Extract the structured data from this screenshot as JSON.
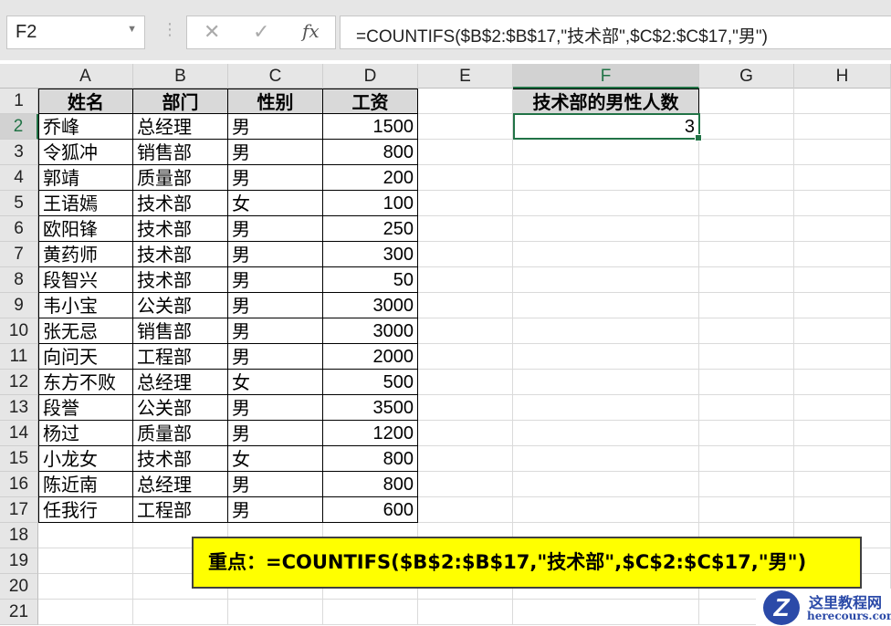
{
  "formula_bar": {
    "name_box": "F2",
    "cancel_icon": "✕",
    "enter_icon": "✓",
    "fx_label": "fx",
    "formula": "=COUNTIFS($B$2:$B$17,\"技术部\",$C$2:$C$17,\"男\")"
  },
  "columns": [
    "A",
    "B",
    "C",
    "D",
    "E",
    "F",
    "G",
    "H"
  ],
  "selected_cell": "F2",
  "table": {
    "headers": [
      "姓名",
      "部门",
      "性别",
      "工资"
    ],
    "rows": [
      [
        "乔峰",
        "总经理",
        "男",
        "1500"
      ],
      [
        "令狐冲",
        "销售部",
        "男",
        "800"
      ],
      [
        "郭靖",
        "质量部",
        "男",
        "200"
      ],
      [
        "王语嫣",
        "技术部",
        "女",
        "100"
      ],
      [
        "欧阳锋",
        "技术部",
        "男",
        "250"
      ],
      [
        "黄药师",
        "技术部",
        "男",
        "300"
      ],
      [
        "段智兴",
        "技术部",
        "男",
        "50"
      ],
      [
        "韦小宝",
        "公关部",
        "男",
        "3000"
      ],
      [
        "张无忌",
        "销售部",
        "男",
        "3000"
      ],
      [
        "向问天",
        "工程部",
        "男",
        "2000"
      ],
      [
        "东方不败",
        "总经理",
        "女",
        "500"
      ],
      [
        "段誉",
        "公关部",
        "男",
        "3500"
      ],
      [
        "杨过",
        "质量部",
        "男",
        "1200"
      ],
      [
        "小龙女",
        "技术部",
        "女",
        "800"
      ],
      [
        "陈近南",
        "总经理",
        "男",
        "800"
      ],
      [
        "任我行",
        "工程部",
        "男",
        "600"
      ]
    ]
  },
  "result": {
    "header": "技术部的男性人数",
    "value": "3"
  },
  "callout": "重点：=COUNTIFS($B$2:$B$17,\"技术部\",$C$2:$C$17,\"男\")",
  "watermark": {
    "title": "这里教程网",
    "url": "herecours.com"
  },
  "colors": {
    "accent": "#217346",
    "callout_bg": "#ffff00",
    "header_fill": "#d9d9d9"
  }
}
